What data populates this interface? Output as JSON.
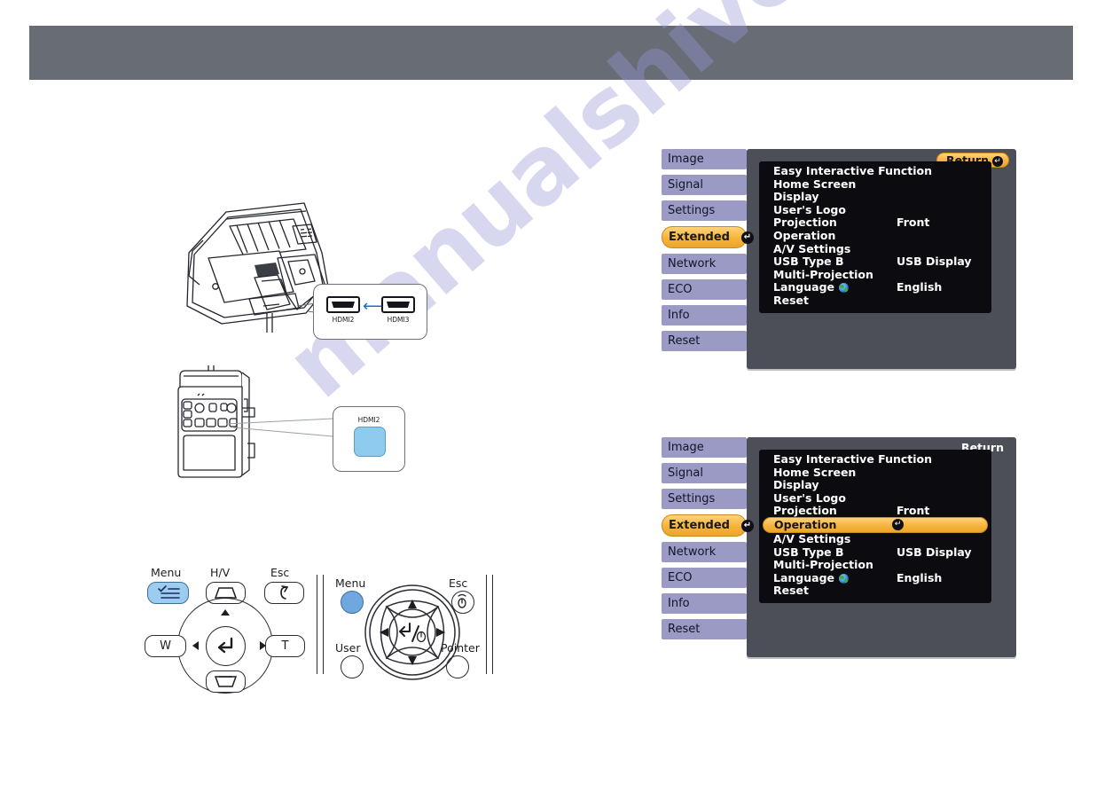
{
  "page": {
    "watermark": "manualshive.com",
    "header_color": "#686c75",
    "accent_orange": "#f6b33c",
    "tab_purple": "#9b9ac4",
    "menu_dark": "#4c4f57",
    "menu_black": "#0b0b10"
  },
  "diagram_top": {
    "callout": {
      "port_left_label": "HDMI2",
      "port_right_label": "HDMI3",
      "arrow_icon": "double-arrow-icon",
      "arrow_color": "#1d6fbe"
    },
    "projector_icon": "projector-device-illustration"
  },
  "diagram_bottom": {
    "callout": {
      "button_label": "HDMI2",
      "button_color": "#8ecbef"
    },
    "device_icon": "control-box-illustration"
  },
  "control_panel": {
    "title_icon": "projector-control-panel",
    "keys": [
      {
        "name": "menu",
        "label": "Menu",
        "icon": "menu-list-icon",
        "highlight": true
      },
      {
        "name": "hv-keystone",
        "label": "H/V",
        "icon": "keystone-up-icon",
        "highlight": false
      },
      {
        "name": "esc",
        "label": "Esc",
        "icon": "esc-return-icon",
        "highlight": false
      },
      {
        "name": "wide",
        "label": "W",
        "icon": "",
        "highlight": false
      },
      {
        "name": "tele",
        "label": "T",
        "icon": "",
        "highlight": false
      },
      {
        "name": "enter",
        "label": "",
        "icon": "enter-arrow-icon",
        "highlight": false
      },
      {
        "name": "keystone-down",
        "label": "",
        "icon": "keystone-down-icon",
        "highlight": false
      }
    ]
  },
  "remote": {
    "title_icon": "remote-control",
    "keys": [
      {
        "name": "menu",
        "label": "Menu",
        "highlight": true
      },
      {
        "name": "esc",
        "label": "Esc",
        "icon": "esc-pointer-icon",
        "highlight": false
      },
      {
        "name": "user",
        "label": "User",
        "highlight": false
      },
      {
        "name": "pointer",
        "label": "Pointer",
        "highlight": false
      },
      {
        "name": "enter",
        "label": "",
        "icon": "enter-mouse-icon",
        "highlight": false
      }
    ]
  },
  "menus": [
    {
      "id": "menu-extended-overview",
      "tabs": [
        {
          "label": "Image",
          "selected": false
        },
        {
          "label": "Signal",
          "selected": false
        },
        {
          "label": "Settings",
          "selected": false
        },
        {
          "label": "Extended",
          "selected": true
        },
        {
          "label": "Network",
          "selected": false
        },
        {
          "label": "ECO",
          "selected": false
        },
        {
          "label": "Info",
          "selected": false
        },
        {
          "label": "Reset",
          "selected": false
        }
      ],
      "return": {
        "label": "Return",
        "highlighted": true,
        "icon": "enter-key-icon"
      },
      "rows": [
        {
          "label": "Easy Interactive Function",
          "value": "",
          "highlighted": false
        },
        {
          "label": "Home Screen",
          "value": "",
          "highlighted": false
        },
        {
          "label": "Display",
          "value": "",
          "highlighted": false
        },
        {
          "label": "User's Logo",
          "value": "",
          "highlighted": false
        },
        {
          "label": "Projection",
          "value": "Front",
          "highlighted": false
        },
        {
          "label": "Operation",
          "value": "",
          "highlighted": false
        },
        {
          "label": "A/V Settings",
          "value": "",
          "highlighted": false
        },
        {
          "label": "USB Type B",
          "value": "USB Display",
          "highlighted": false
        },
        {
          "label": "Multi-Projection",
          "value": "",
          "highlighted": false
        },
        {
          "label": "Language",
          "value": "English",
          "highlighted": false,
          "icon": "globe-icon"
        },
        {
          "label": "Reset",
          "value": "",
          "highlighted": false
        }
      ]
    },
    {
      "id": "menu-extended-operation-selected",
      "tabs": [
        {
          "label": "Image",
          "selected": false
        },
        {
          "label": "Signal",
          "selected": false
        },
        {
          "label": "Settings",
          "selected": false
        },
        {
          "label": "Extended",
          "selected": true
        },
        {
          "label": "Network",
          "selected": false
        },
        {
          "label": "ECO",
          "selected": false
        },
        {
          "label": "Info",
          "selected": false
        },
        {
          "label": "Reset",
          "selected": false
        }
      ],
      "return": {
        "label": "Return",
        "highlighted": false,
        "icon": ""
      },
      "rows": [
        {
          "label": "Easy Interactive Function",
          "value": "",
          "highlighted": false
        },
        {
          "label": "Home Screen",
          "value": "",
          "highlighted": false
        },
        {
          "label": "Display",
          "value": "",
          "highlighted": false
        },
        {
          "label": "User's Logo",
          "value": "",
          "highlighted": false
        },
        {
          "label": "Projection",
          "value": "Front",
          "highlighted": false
        },
        {
          "label": "Operation",
          "value": "",
          "highlighted": true,
          "icon": "enter-key-icon"
        },
        {
          "label": "A/V Settings",
          "value": "",
          "highlighted": false
        },
        {
          "label": "USB Type B",
          "value": "USB Display",
          "highlighted": false
        },
        {
          "label": "Multi-Projection",
          "value": "",
          "highlighted": false
        },
        {
          "label": "Language",
          "value": "English",
          "highlighted": false,
          "icon": "globe-icon"
        },
        {
          "label": "Reset",
          "value": "",
          "highlighted": false
        }
      ]
    }
  ]
}
